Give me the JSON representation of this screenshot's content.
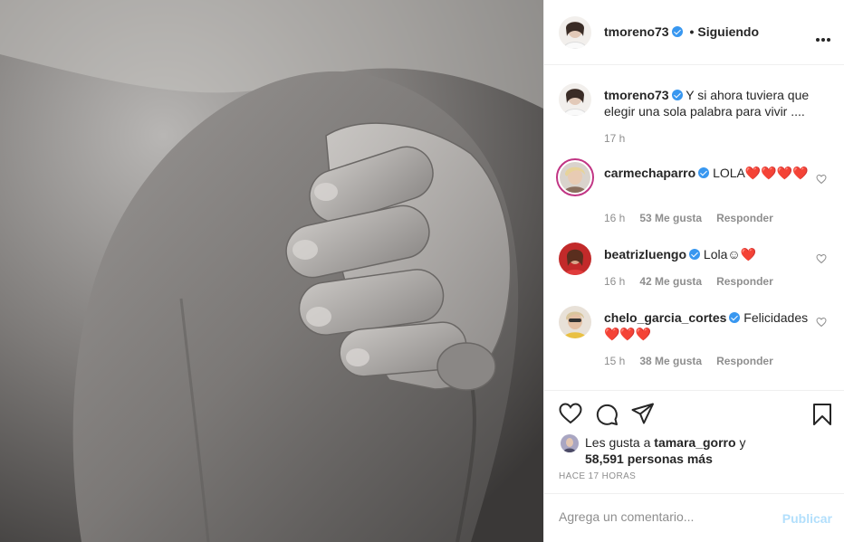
{
  "post": {
    "image_alt": "Mano de bebé sobre la mano de un adulto (blanco y negro)"
  },
  "header": {
    "username": "tmoreno73",
    "dot": "•",
    "follow_status": "Siguiendo"
  },
  "caption": {
    "username": "tmoreno73",
    "text": "Y si ahora tuviera que elegir una sola palabra para vivir ....",
    "time": "17 h"
  },
  "comments": [
    {
      "username": "carmechaparro",
      "text": "LOLA❤️❤️❤️❤️",
      "time": "16 h",
      "likes": "53 Me gusta",
      "reply": "Responder"
    },
    {
      "username": "beatrizluengo",
      "text": "Lola☺❤️",
      "time": "16 h",
      "likes": "42 Me gusta",
      "reply": "Responder"
    },
    {
      "username": "chelo_garcia_cortes",
      "text": "Felicidades ❤️❤️❤️",
      "time": "15 h",
      "likes": "38 Me gusta",
      "reply": "Responder"
    }
  ],
  "likes": {
    "prefix": "Les gusta a",
    "user": "tamara_gorro",
    "conj": "y",
    "count": "58,591 personas más"
  },
  "time_ago": "Hace 17 horas",
  "add_comment": {
    "placeholder": "Agrega un comentario...",
    "post_label": "Publicar"
  },
  "icons": {
    "like": "heart-icon",
    "comment": "comment-icon",
    "share": "paper-plane-icon",
    "save": "bookmark-icon",
    "more": "more-dots-icon"
  },
  "colors": {
    "verified": "#3897f0",
    "meta_text": "#8e8e8e",
    "publish_disabled": "#b2dffc"
  }
}
